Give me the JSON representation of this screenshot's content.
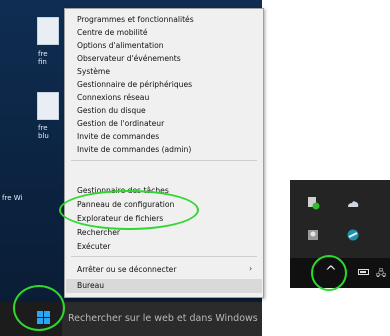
{
  "desktop": {
    "icons": [
      {
        "label_lines": [
          "fre",
          "fin"
        ]
      },
      {
        "label_lines": [
          "fre",
          "blu"
        ]
      },
      {
        "label_lines": [
          "fre Wi"
        ]
      }
    ]
  },
  "context_menu": {
    "items": [
      "Programmes et fonctionnalités",
      "Centre de mobilité",
      "Options d'alimentation",
      "Observateur d'événements",
      "Système",
      "Gestionnaire de périphériques",
      "Connexions réseau",
      "Gestion du disque",
      "Gestion de l'ordinateur",
      "Invite de commandes",
      "Invite de commandes (admin)",
      "Gestionnaire des tâches",
      "Panneau de configuration",
      "Explorateur de fichiers",
      "Rechercher",
      "Exécuter",
      "Arrêter ou se déconnecter",
      "Bureau"
    ],
    "submenu_chevron": "›",
    "highlighted_item": "Bureau"
  },
  "taskbar": {
    "search_placeholder": "Rechercher sur le web et dans Windows"
  },
  "tray": {
    "overflow_caret": "^",
    "network_glyph": "🖧"
  },
  "colors": {
    "highlight_circle": "#2ed82e",
    "windows_blue": "#2aa7f3"
  }
}
